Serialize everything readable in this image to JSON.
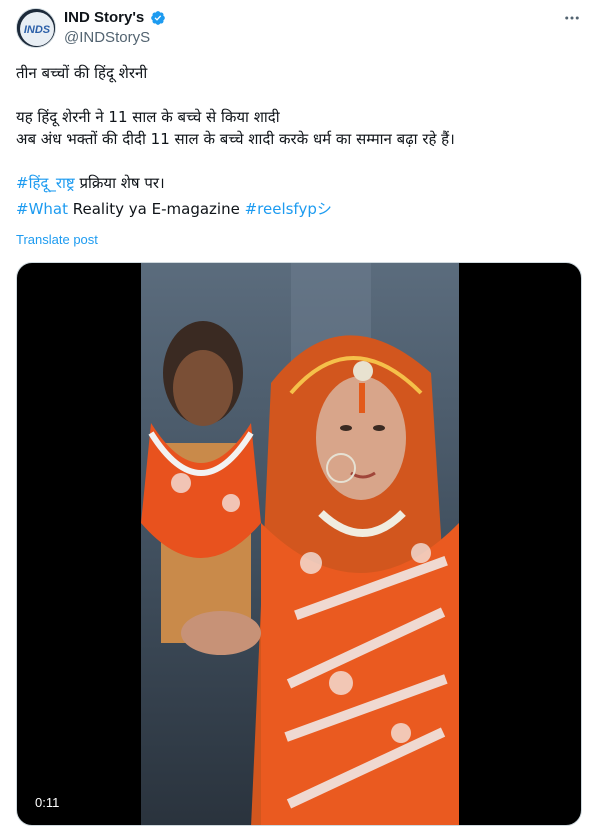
{
  "author": {
    "display_name": "IND Story's",
    "handle": "@INDStoryS",
    "avatar_text": "INDS"
  },
  "tweet": {
    "line1": "तीन बच्चों की हिंदू शेरनी",
    "line2": "यह हिंदू शेरनी ने 11 साल के बच्चे से किया शादी",
    "line3": "अब अंध भक्तों की दीदी 11 साल के बच्चे शादी करके धर्म का सम्मान बढ़ा रहे हैं।",
    "line4_tag": "#हिंदू_राष्ट्र",
    "line4_rest": " प्रक्रिया शेष पर।",
    "line5_tag1": "#What",
    "line5_mid": " Reality ya E-magazine ",
    "line5_tag2": "#reelsfypシ"
  },
  "translate_label": "Translate post",
  "video": {
    "duration": "0:11"
  },
  "icons": {
    "verified": "verified-badge-icon",
    "more": "more-dots-icon"
  },
  "colors": {
    "accent": "#1d9bf0",
    "text": "#0f1419",
    "secondary": "#536471"
  }
}
